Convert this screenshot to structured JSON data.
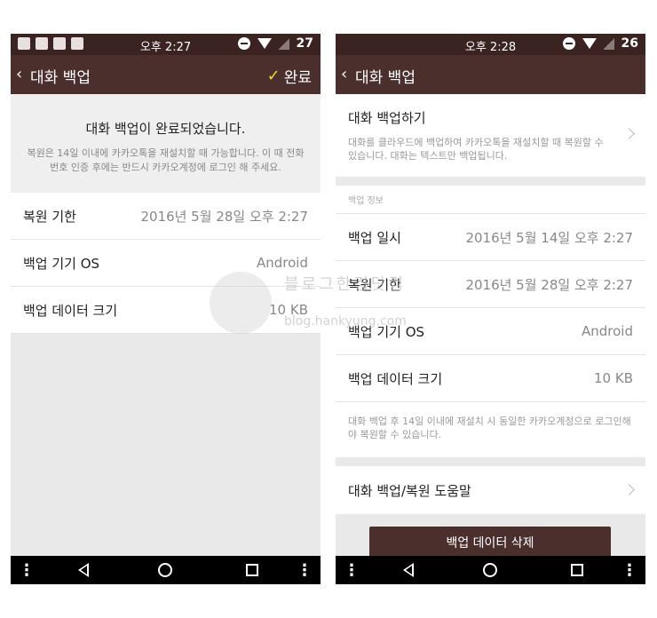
{
  "left": {
    "status_time": "오후 2:27",
    "battery": "27",
    "title": "대화 백업",
    "done_label": "완료",
    "message_title": "대화 백업이 완료되었습니다.",
    "message_sub": "복원은 14일 이내에 카카오톡을 재설치할 때 가능합니다. 이 때 전화번호 인증 후에는 반드시 카카오계정에 로그인 해 주세요.",
    "rows": [
      {
        "label": "복원 기한",
        "value": "2016년 5월 28일 오후 2:27"
      },
      {
        "label": "백업 기기 OS",
        "value": "Android"
      },
      {
        "label": "백업 데이터 크기",
        "value": "10 KB"
      }
    ]
  },
  "right": {
    "status_time": "오후 2:28",
    "battery": "26",
    "title": "대화 백업",
    "backup_action": "대화 백업하기",
    "backup_desc": "대화를 클라우드에 백업하여 카카오톡을 재설치할 때 복원할 수 있습니다. 대화는 텍스트만 백업됩니다.",
    "section_label": "백업 정보",
    "rows": [
      {
        "label": "백업 일시",
        "value": "2016년 5월 14일 오후 2:27"
      },
      {
        "label": "복원 기한",
        "value": "2016년 5월 28일 오후 2:27"
      },
      {
        "label": "백업 기기 OS",
        "value": "Android"
      },
      {
        "label": "백업 데이터 크기",
        "value": "10 KB"
      }
    ],
    "note": "대화 백업 후 14일 이내에 재설치 시 동일한 카카오계정으로 로그인해야 복원할 수 있습니다.",
    "help": "대화 백업/복원 도움말",
    "delete_button": "백업 데이터 삭제"
  },
  "watermark": {
    "line1": "블로그한경닷컴",
    "line2": "blog.hankyung.com"
  },
  "colors": {
    "appbar": "#4b2f2c",
    "statusbar": "#3a2321",
    "check": "#f2d22e"
  }
}
